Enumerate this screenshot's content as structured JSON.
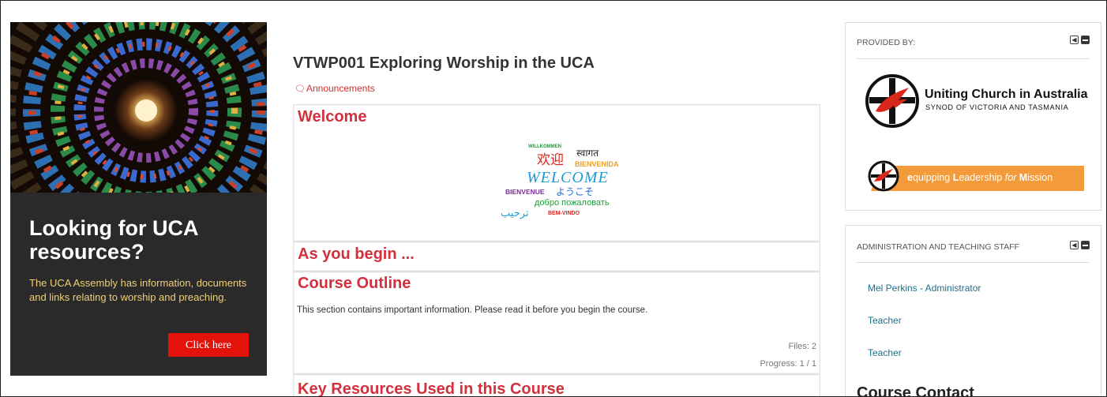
{
  "promo": {
    "title": "Looking for UCA resources?",
    "text": "The UCA Assembly has information, documents and links relating to worship and preaching.",
    "button_label": "Click here"
  },
  "course": {
    "title": "VTWP001 Exploring Worship in the UCA",
    "announcements_label": "Announcements"
  },
  "sections": {
    "welcome": {
      "title": "Welcome",
      "cloud_words": {
        "willkommen": "WILLKOMMEN",
        "swagat": "स्वागत",
        "huanying": "欢迎",
        "bienvenida": "BIENVENIDA",
        "welcome": "WELCOME",
        "bienvenue": "BIENVENUE",
        "youkoso": "ようこそ",
        "russian": "добро пожаловать",
        "arabic": "ترحيب",
        "bemvindo": "BEM-VINDO"
      }
    },
    "as_you_begin": {
      "title": "As you begin ..."
    },
    "course_outline": {
      "title": "Course Outline",
      "summary": "This section contains important information. Please read it before you begin the course.",
      "files": "Files: 2",
      "progress": "Progress: 1 / 1"
    },
    "key_resources": {
      "title": "Key Resources Used in this Course"
    }
  },
  "blocks": {
    "provided_by": {
      "header": "PROVIDED BY:",
      "uca_name": "Uniting Church in Australia",
      "uca_synod": "SYNOD OF VICTORIA AND TASMANIA",
      "elm": {
        "e": "e",
        "quipping": "quipping ",
        "L": "L",
        "eadership": "eadership ",
        "for": "for",
        "M": "M",
        "ission": "ission"
      }
    },
    "staff": {
      "header": "ADMINISTRATION AND TEACHING STAFF",
      "members": [
        "Mel Perkins - Administrator",
        "Teacher",
        "Teacher"
      ]
    },
    "contact": {
      "header": "Course Contact"
    }
  },
  "colors": {
    "accent": "#d32f3c",
    "button": "#e3130c",
    "promo_bg": "#2a2a2a",
    "promo_text": "#f0cf78",
    "link": "#1f6f8b",
    "elm_orange": "#f39a3a"
  }
}
